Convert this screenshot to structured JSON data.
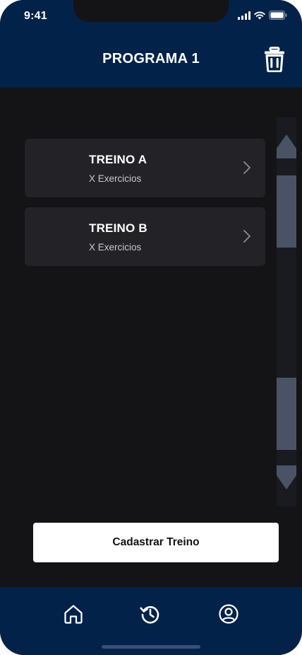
{
  "status_bar": {
    "time": "9:41"
  },
  "header": {
    "title": "PROGRAMA 1"
  },
  "workouts": [
    {
      "title": "TREINO A",
      "subtitle": "X Exercicios"
    },
    {
      "title": "TREINO B",
      "subtitle": "X Exercicios"
    }
  ],
  "actions": {
    "register_workout": "Cadastrar Treino"
  },
  "tab_bar": {
    "items": [
      "home-icon",
      "history-icon",
      "profile-icon"
    ]
  },
  "colors": {
    "header_bg": "#02224a",
    "background": "#141416",
    "card_bg": "#232327",
    "scroll_thumb": "#4a5366"
  }
}
